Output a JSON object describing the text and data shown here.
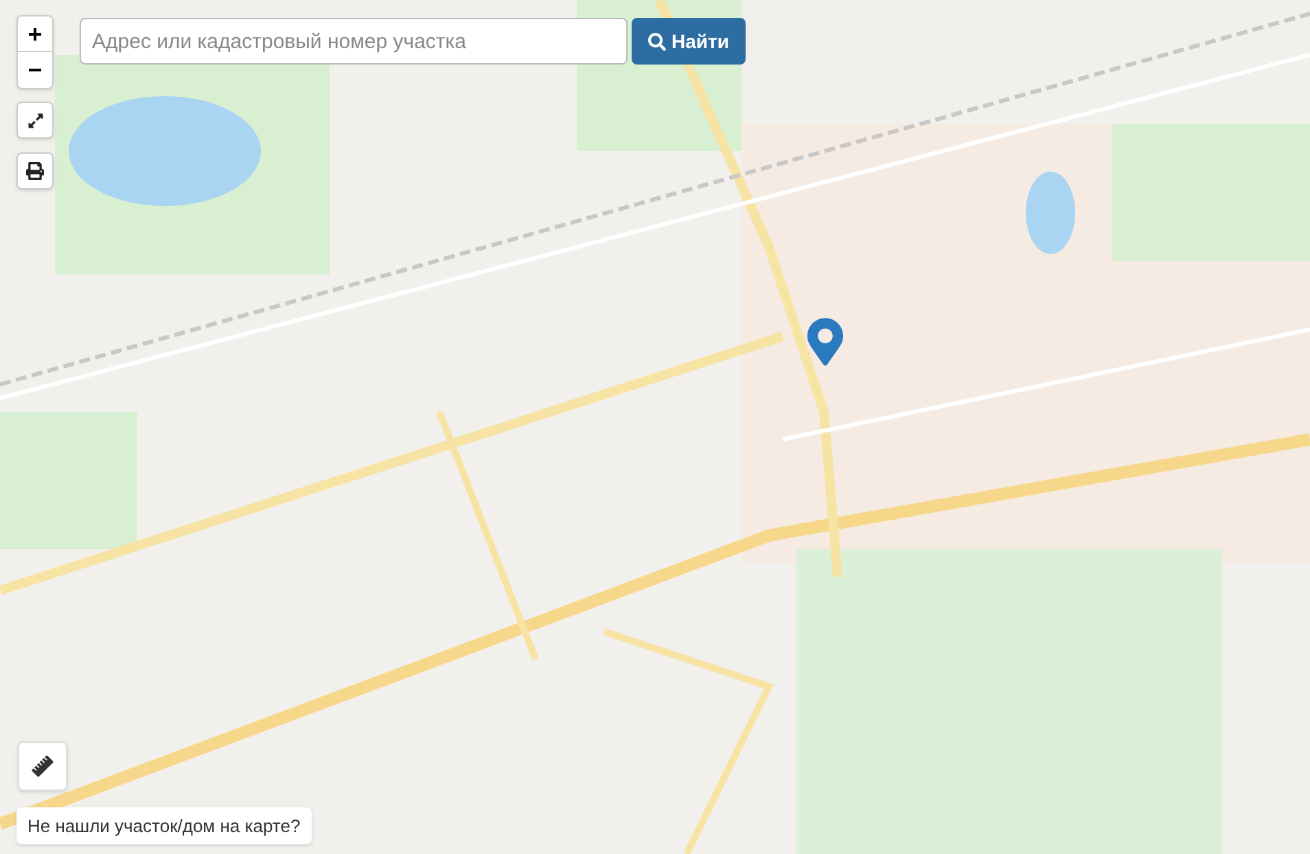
{
  "zoom": {
    "in": "+",
    "out": "−"
  },
  "search": {
    "placeholder": "Адрес или кадастровый номер участка",
    "button": "Найти"
  },
  "report_link": "Не нашли участок/дом на карте?"
}
